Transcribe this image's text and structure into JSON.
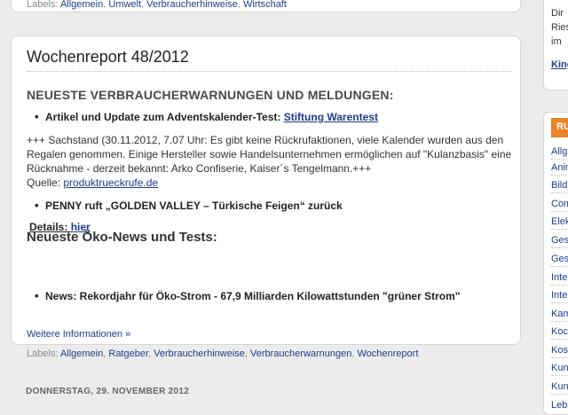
{
  "prev_post": {
    "labels_prefix": "Labels:",
    "labels": [
      "Allgemein",
      "Umwelt",
      "Verbraucherhinweise",
      "Wirtschaft"
    ]
  },
  "post": {
    "title": "Wochenreport 48/2012",
    "section1_heading": "NEUESTE VERBRAUCHERWARNUNGEN UND MELDUNGEN:",
    "bullet1_text": "Artikel und Update zum Adventskalender-Test: ",
    "bullet1_link": "Stiftung Warentest",
    "paragraph_text": "+++  Sachstand (30.11.2012, 7.07 Uhr: Es gibt keine Rückrufaktionen, viele Kalender wurden aus den Regalen genommen. Einige Hersteller sowie Handelsunternehmen ermöglichen auf \"Kulanzbasis\" eine Rücknahme - derzeit bekannt: Arko Confiserie, Kaiser´s Tengelmann.+++",
    "source_label": "Quelle: ",
    "source_link": "produktrueckrufe.de",
    "bullet2_text": "PENNY ruft „GOLDEN VALLEY – Türkische Feigen“ zurück",
    "details_label": "Details: ",
    "details_link": "hier",
    "section2_heading": "Neueste Öko-News und Tests:",
    "bullet3_text": "News: Rekordjahr für Öko-Strom - 67,9 Milliarden Kilowattstunden \"grüner Strom\"",
    "more_link": "Weitere Informationen »",
    "labels_prefix": "Labels:",
    "labels": [
      "Allgemein",
      "Ratgeber",
      "Verbraucherhinweise",
      "Verbraucherwarnungen",
      "Wochenreport"
    ]
  },
  "next_date_header": "DONNERSTAG, 29. NOVEMBER 2012",
  "sidebar": {
    "box1_lines": [
      "Dir",
      "Ries",
      "im"
    ],
    "box1_link": "King",
    "box2_heading": "RU",
    "items": [
      "Allg",
      "Anim",
      "Bild",
      "Com",
      "Elek",
      "Ges",
      "Gesu",
      "Inte",
      "Inte",
      "Kam",
      "Koc",
      "Kos",
      "Kun",
      "Kun",
      "Leb"
    ]
  },
  "colors": {
    "link": "#1a3d8c",
    "sidebar_heading_bg": "#e8842a",
    "page_bg": "#ececec"
  }
}
